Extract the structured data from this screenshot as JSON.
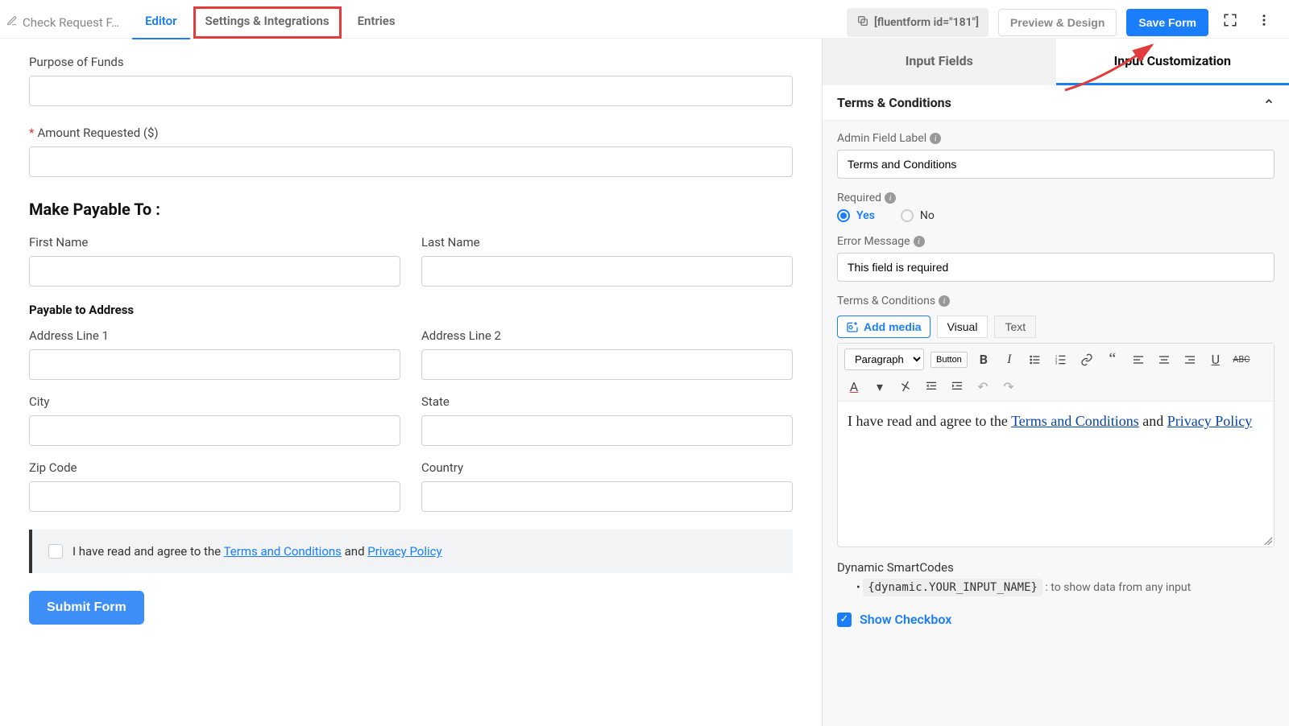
{
  "top": {
    "form_title": "Check Request F…",
    "tabs": {
      "editor": "Editor",
      "settings": "Settings & Integrations",
      "entries": "Entries"
    },
    "shortcode": "[fluentform id=\"181\"]",
    "preview_btn": "Preview & Design",
    "save_btn": "Save Form"
  },
  "form": {
    "purpose_label": "Purpose of Funds",
    "amount_label": "Amount Requested ($)",
    "section_payable": "Make Payable To :",
    "first_name": "First Name",
    "last_name": "Last Name",
    "address_section": "Payable to Address",
    "addr1": "Address Line 1",
    "addr2": "Address Line 2",
    "city": "City",
    "state": "State",
    "zip": "Zip Code",
    "country": "Country",
    "tc_prefix": "I have read and agree to the ",
    "tc_link1": "Terms and Conditions",
    "tc_and": " and ",
    "tc_link2": "Privacy Policy",
    "submit": "Submit Form"
  },
  "side": {
    "tab_fields": "Input Fields",
    "tab_custom": "Input Customization",
    "panel_title": "Terms & Conditions",
    "admin_label": "Admin Field Label",
    "admin_value": "Terms and Conditions",
    "required_label": "Required",
    "yes": "Yes",
    "no": "No",
    "error_label": "Error Message",
    "error_value": "This field is required",
    "tc_label": "Terms & Conditions",
    "add_media": "Add media",
    "visual": "Visual",
    "text_tab": "Text",
    "paragraph": "Paragraph",
    "button_label": "Button",
    "ed_prefix": "I have read and agree to the ",
    "ed_link1": "Terms and Conditions",
    "ed_and": " and ",
    "ed_link2": "Privacy Policy",
    "smartcodes_title": "Dynamic SmartCodes",
    "smart_code": "{dynamic.YOUR_INPUT_NAME}",
    "smart_note": ": to show data from any input",
    "show_checkbox": "Show Checkbox"
  }
}
